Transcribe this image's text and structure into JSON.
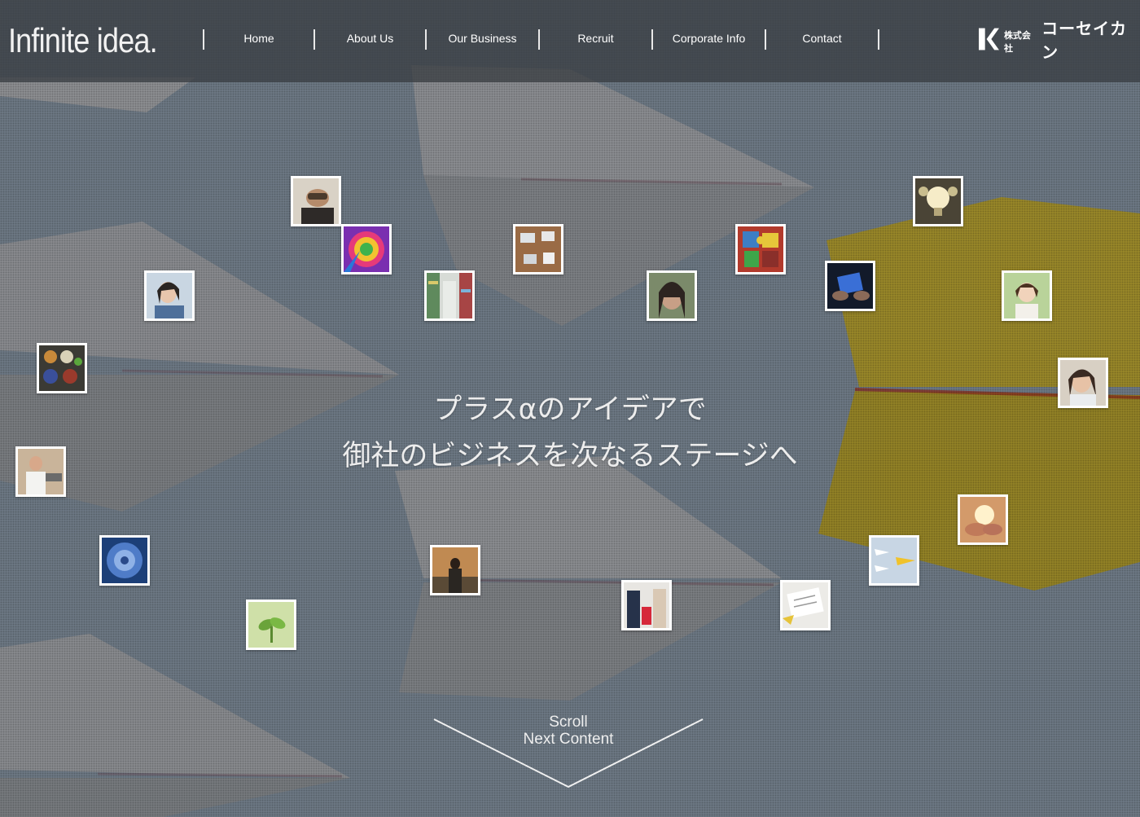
{
  "header": {
    "brand": "Infinite idea.",
    "nav": [
      "Home",
      "About Us",
      "Our Business",
      "Recruit",
      "Corporate Info",
      "Contact"
    ],
    "logo_small": "株式会社",
    "logo_name": "コーセイカン"
  },
  "hero": {
    "line1": "プラスαのアイデアで",
    "line2": "御社のビジネスを次なるステージへ"
  },
  "scroll": {
    "line1": "Scroll",
    "line2": "Next Content"
  },
  "colors": {
    "background": "#6e7a86",
    "accent_panel": "#9a8a2a",
    "header_bg": "#3a3e42"
  }
}
